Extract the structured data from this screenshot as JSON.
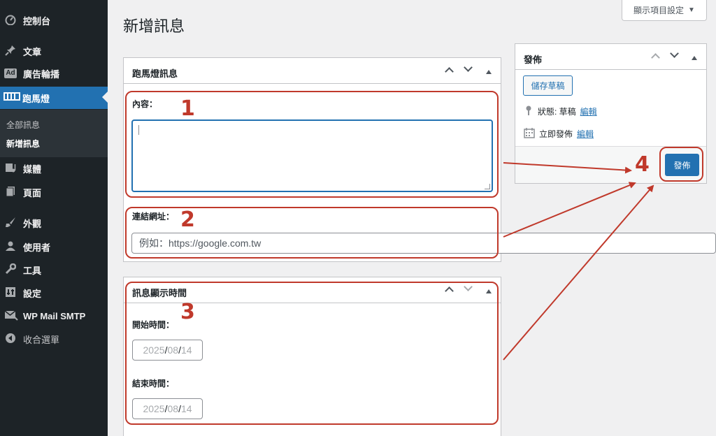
{
  "sidebar": {
    "items": [
      {
        "label": "控制台",
        "icon": "dashboard-icon"
      },
      {
        "label": "文章",
        "icon": "pin-icon"
      },
      {
        "label": "廣告輪播",
        "icon": "ad-icon"
      },
      {
        "label": "跑馬燈",
        "icon": "marquee-icon"
      },
      {
        "label": "媒體",
        "icon": "media-icon"
      },
      {
        "label": "頁面",
        "icon": "page-icon"
      },
      {
        "label": "外觀",
        "icon": "brush-icon"
      },
      {
        "label": "使用者",
        "icon": "user-icon"
      },
      {
        "label": "工具",
        "icon": "wrench-icon"
      },
      {
        "label": "設定",
        "icon": "settings-icon"
      },
      {
        "label": "WP Mail SMTP",
        "icon": "mail-icon"
      },
      {
        "label": "收合選單",
        "icon": "collapse-icon"
      }
    ],
    "submenu": [
      {
        "label": "全部訊息"
      },
      {
        "label": "新增訊息"
      }
    ],
    "ad_icon_text": "Ad"
  },
  "header": {
    "title": "新增訊息",
    "screen_options": "顯示項目設定",
    "screen_options_caret": "▼"
  },
  "marquee_box": {
    "title": "跑馬燈訊息",
    "content_label": "內容：",
    "content_value": "",
    "url_label": "連結網址：",
    "url_placeholder": "例如：https://google.com.tw"
  },
  "time_box": {
    "title": "訊息顯示時間",
    "start_label": "開始時間：",
    "end_label": "結束時間：",
    "start_date": {
      "y": "2025",
      "m": "08",
      "d": "14"
    },
    "end_date": {
      "y": "2025",
      "m": "08",
      "d": "14"
    }
  },
  "publish_box": {
    "title": "發佈",
    "save_draft": "儲存草稿",
    "status_text": "狀態: 草稿",
    "status_edit": "編輯",
    "schedule_text": "立即發佈",
    "schedule_edit": "編輯",
    "publish_button": "發佈"
  },
  "annotations": [
    "1",
    "2",
    "3",
    "4"
  ],
  "colors": {
    "accent": "#2271b1",
    "annotation": "#c0392b",
    "sidebar": "#1d2327"
  }
}
